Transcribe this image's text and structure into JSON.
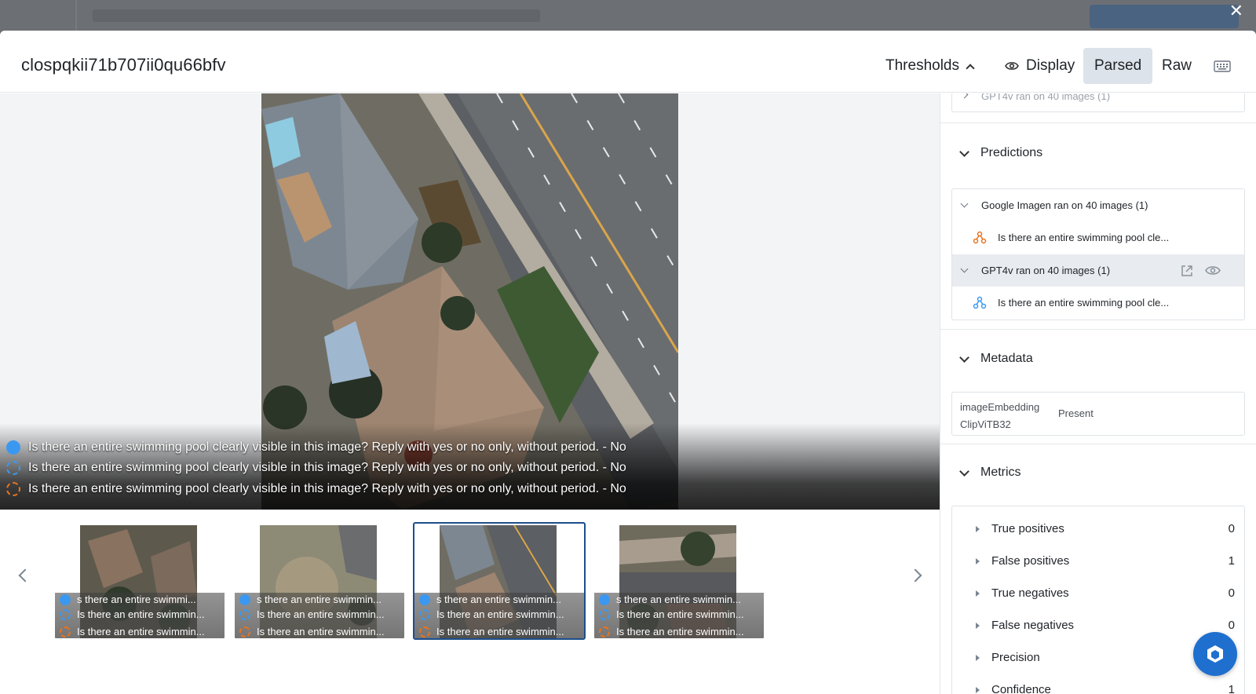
{
  "window": {
    "close_label": "✕"
  },
  "header": {
    "title": "clospqkii71b707ii0qu66bfv",
    "thresholds_label": "Thresholds",
    "display_label": "Display",
    "parsed_label": "Parsed",
    "raw_label": "Raw"
  },
  "viewer": {
    "captions": [
      {
        "icon": "solid-blue",
        "text": "Is there an entire swimming pool clearly visible in this image? Reply with yes or no only, without period. - No"
      },
      {
        "icon": "dashed-blue",
        "text": "Is there an entire swimming pool clearly visible in this image? Reply with yes or no only, without period. - No"
      },
      {
        "icon": "dashed-orange",
        "text": "Is there an entire swimming pool clearly visible in this image? Reply with yes or no only, without period. - No"
      }
    ]
  },
  "thumbnails": {
    "items": [
      {
        "selected": false,
        "lines": [
          "s there an entire swimmi...",
          "Is there an entire swimmin...",
          "Is there an entire swimmin..."
        ]
      },
      {
        "selected": false,
        "lines": [
          "s there an entire swimmin...",
          "Is there an entire swimmin...",
          "Is there an entire swimmin..."
        ]
      },
      {
        "selected": true,
        "lines": [
          "s there an entire swimmin...",
          "Is there an entire swimmin...",
          "Is there an entire swimmin..."
        ]
      },
      {
        "selected": false,
        "lines": [
          "s there an entire swimmin...",
          "Is there an entire swimmin...",
          "Is there an entire swimmin..."
        ]
      }
    ]
  },
  "panel": {
    "top_row": "GPT4v ran on 40 images (1)",
    "predictions": {
      "title": "Predictions",
      "groups": [
        {
          "label": "Google Imagen ran on 40 images (1)",
          "item": "Is there an entire swimming pool cle...",
          "icon_color": "#e8731f"
        },
        {
          "label": "GPT4v ran on 40 images (1)",
          "item": "Is there an entire swimming pool cle...",
          "icon_color": "#3b98f0"
        }
      ]
    },
    "metadata": {
      "title": "Metadata",
      "key_line1": "imageEmbedding",
      "key_line2": "ClipViTB32",
      "value": "Present"
    },
    "metrics": {
      "title": "Metrics",
      "rows": [
        {
          "label": "True positives",
          "value": "0"
        },
        {
          "label": "False positives",
          "value": "1"
        },
        {
          "label": "True negatives",
          "value": "0"
        },
        {
          "label": "False negatives",
          "value": "0"
        },
        {
          "label": "Precision",
          "value": ""
        },
        {
          "label": "Confidence",
          "value": "1"
        }
      ]
    }
  },
  "colors": {
    "accent": "#1d4e8c",
    "blue": "#3b98f0",
    "orange": "#e8731f",
    "fab": "#1f6fcf"
  }
}
